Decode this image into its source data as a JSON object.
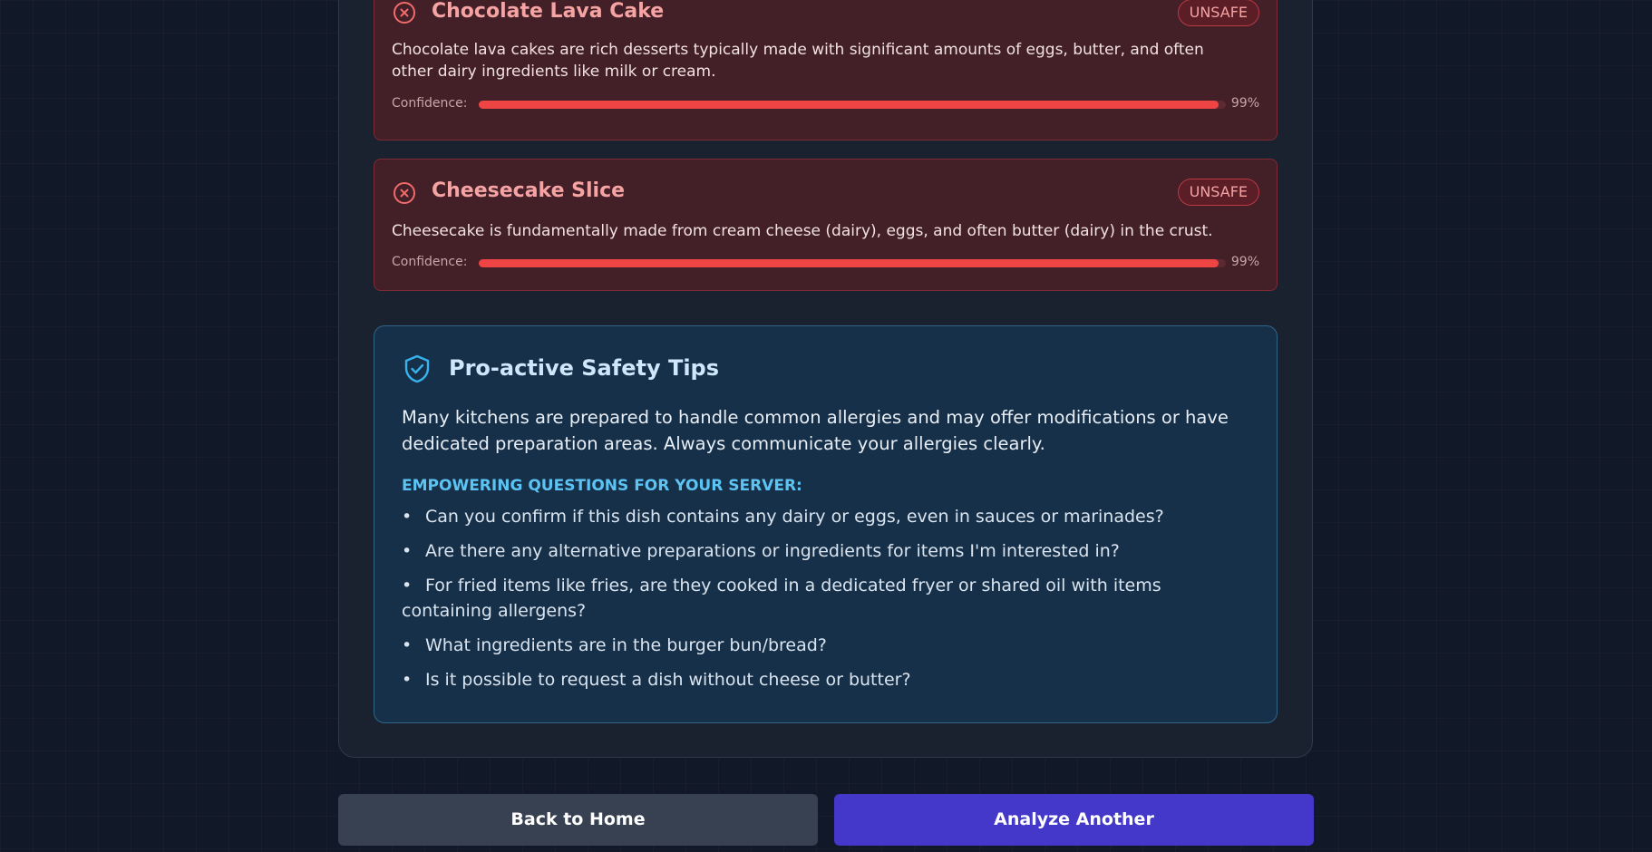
{
  "items": [
    {
      "name": "Chocolate Lava Cake",
      "status": "UNSAFE",
      "description": "Chocolate lava cakes are rich desserts typically made with significant amounts of eggs, butter, and often other dairy ingredients like milk or cream.",
      "confidence_label": "Confidence:",
      "confidence_value": 0.99,
      "confidence_text": "99%"
    },
    {
      "name": "Cheesecake Slice",
      "status": "UNSAFE",
      "description": "Cheesecake is fundamentally made from cream cheese (dairy), eggs, and often butter (dairy) in the crust.",
      "confidence_label": "Confidence:",
      "confidence_value": 0.99,
      "confidence_text": "99%"
    }
  ],
  "tips": {
    "title": "Pro-active Safety Tips",
    "intro": "Many kitchens are prepared to handle common allergies and may offer modifications or have dedicated preparation areas. Always communicate your allergies clearly.",
    "questions_heading": "EMPOWERING QUESTIONS FOR YOUR SERVER:",
    "questions": [
      "Can you confirm if this dish contains any dairy or eggs, even in sauces or marinades?",
      "Are there any alternative preparations or ingredients for items I'm interested in?",
      "For fried items like fries, are they cooked in a dedicated fryer or shared oil with items containing allergens?",
      "What ingredients are in the burger bun/bread?",
      "Is it possible to request a dish without cheese or butter?"
    ]
  },
  "buttons": {
    "back_home": "Back to Home",
    "analyze_another": "Analyze Another"
  },
  "icons": {
    "unsafe": "x-circle-icon",
    "tips": "shield-check-icon"
  },
  "colors": {
    "unsafe_accent": "#ef4444",
    "tips_accent": "#5cc3f2",
    "primary_button": "#4338ca"
  }
}
